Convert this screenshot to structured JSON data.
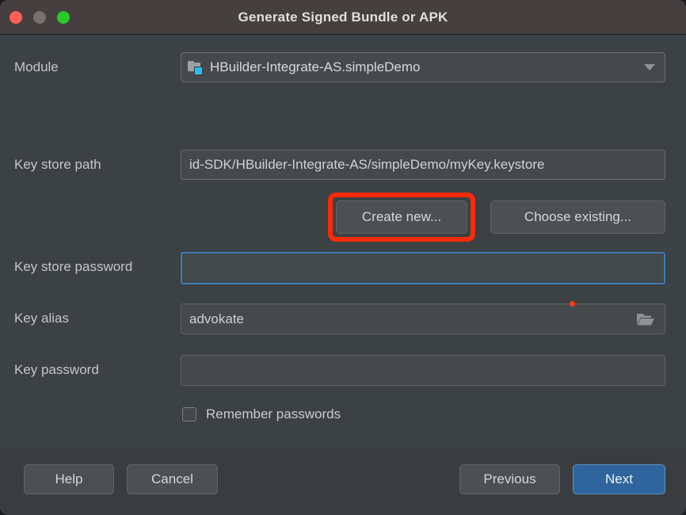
{
  "window": {
    "title": "Generate Signed Bundle or APK",
    "traffic_lights": [
      {
        "name": "close",
        "color": "#ff6157"
      },
      {
        "name": "minimize",
        "color": "#7a6f6d"
      },
      {
        "name": "zoom",
        "color": "#2ac82a"
      }
    ]
  },
  "form": {
    "module": {
      "label": "Module",
      "value": "HBuilder-Integrate-AS.simpleDemo",
      "icon": "module-folder-icon",
      "caret_icon": "chevron-down-icon"
    },
    "key_store_path": {
      "label": "Key store path",
      "value": "id-SDK/HBuilder-Integrate-AS/simpleDemo/myKey.keystore",
      "placeholder": ""
    },
    "create_new_button": "Create new...",
    "choose_existing_button": "Choose existing...",
    "key_store_password": {
      "label": "Key store password",
      "value": "",
      "placeholder": ""
    },
    "key_alias": {
      "label": "Key alias",
      "value": "advokate",
      "placeholder": "",
      "browse_icon": "folder-open-icon"
    },
    "key_password": {
      "label": "Key password",
      "value": "",
      "placeholder": ""
    },
    "remember_passwords": {
      "label": "Remember passwords",
      "checked": false
    }
  },
  "footer": {
    "help": "Help",
    "cancel": "Cancel",
    "previous": "Previous",
    "next": "Next"
  },
  "annotations": {
    "highlight_color": "#fc2a08",
    "dot_color": "#f8391b"
  },
  "colors": {
    "titlebar_bg": "#463f3f",
    "content_bg": "#3c4143",
    "footer_bg": "#393d3f",
    "focus_border": "#3e7ab5",
    "primary_button": "#2f659c",
    "module_badge": "#25bdf0"
  }
}
